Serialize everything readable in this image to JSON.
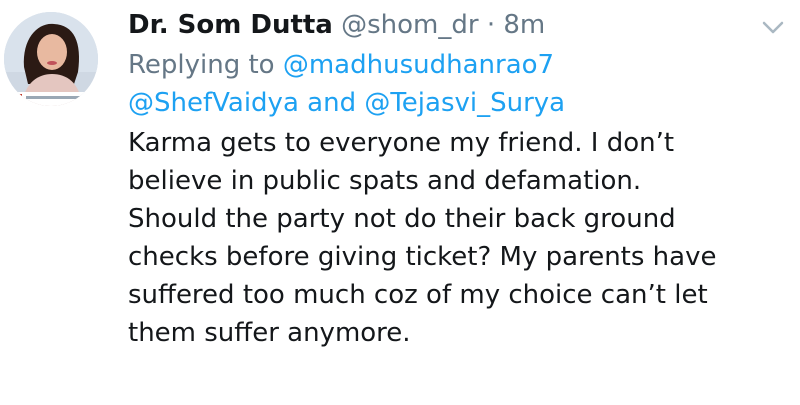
{
  "author": {
    "display_name": "Dr. Som Dutta",
    "handle": "@shom_dr",
    "separator": "·",
    "time": "8m"
  },
  "reply": {
    "prefix": "Replying to",
    "mentions": [
      "@madhusudhanrao7",
      "@ShefVaidya",
      "@Tejasvi_Surya"
    ],
    "conjunction": "and"
  },
  "tweet": {
    "lines": [
      "Karma gets to everyone my friend. I don’t",
      "believe in public spats and defamation.",
      "Should the party not do their back ground",
      "checks before giving ticket? My parents have",
      "suffered too much coz of my choice can’t let",
      "them suffer anymore."
    ]
  },
  "icons": {
    "menu": "chevron-down-icon",
    "avatar": "profile-avatar"
  },
  "colors": {
    "link": "#1da1f2",
    "muted": "#657786",
    "text": "#14171a"
  }
}
